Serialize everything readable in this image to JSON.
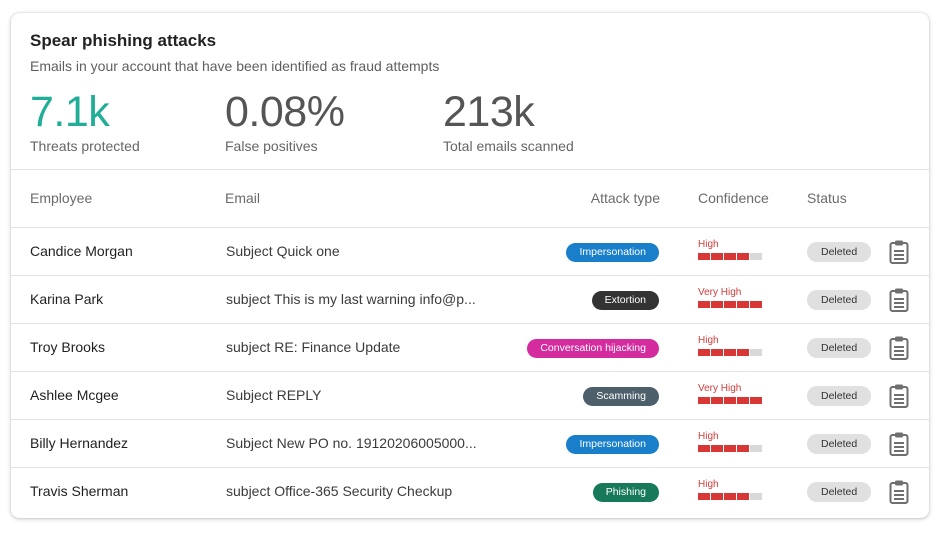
{
  "header": {
    "title": "Spear phishing attacks",
    "subtitle": "Emails in your account that have been identified as fraud attempts"
  },
  "stats": [
    {
      "value": "7.1k",
      "label": "Threats protected",
      "color": "#21ae97"
    },
    {
      "value": "0.08%",
      "label": "False positives",
      "color": "#555555"
    },
    {
      "value": "213k",
      "label": "Total emails scanned",
      "color": "#555555"
    }
  ],
  "table": {
    "columns": {
      "employee": "Employee",
      "email": "Email",
      "attack_type": "Attack type",
      "confidence": "Confidence",
      "status": "Status"
    },
    "rows": [
      {
        "employee": "Candice Morgan",
        "email": "Subject Quick one",
        "attack_type": "Impersonation",
        "attack_color": "#1a7fcb",
        "confidence_label": "High",
        "confidence_level": 4,
        "status": "Deleted",
        "action_icon": "clipboard-icon"
      },
      {
        "employee": "Karina Park",
        "email": "subject This is my last warning info@p...",
        "attack_type": "Extortion",
        "attack_color": "#333333",
        "confidence_label": "Very High",
        "confidence_level": 5,
        "status": "Deleted",
        "action_icon": "clipboard-icon"
      },
      {
        "employee": "Troy Brooks",
        "email": "subject RE: Finance Update",
        "attack_type": "Conversation hijacking",
        "attack_color": "#d42b9e",
        "confidence_label": "High",
        "confidence_level": 4,
        "status": "Deleted",
        "action_icon": "clipboard-icon"
      },
      {
        "employee": "Ashlee Mcgee",
        "email": "Subject REPLY",
        "attack_type": "Scamming",
        "attack_color": "#4d5f6b",
        "confidence_label": "Very High",
        "confidence_level": 5,
        "status": "Deleted",
        "action_icon": "clipboard-icon"
      },
      {
        "employee": "Billy Hernandez",
        "email": "Subject New PO no. 19120206005000...",
        "attack_type": "Impersonation",
        "attack_color": "#1a7fcb",
        "confidence_label": "High",
        "confidence_level": 4,
        "status": "Deleted",
        "action_icon": "clipboard-icon"
      },
      {
        "employee": "Travis Sherman",
        "email": "subject Office-365 Security Checkup",
        "attack_type": "Phishing",
        "attack_color": "#167a5a",
        "confidence_label": "High",
        "confidence_level": 4,
        "status": "Deleted",
        "action_icon": "clipboard-icon"
      }
    ]
  }
}
